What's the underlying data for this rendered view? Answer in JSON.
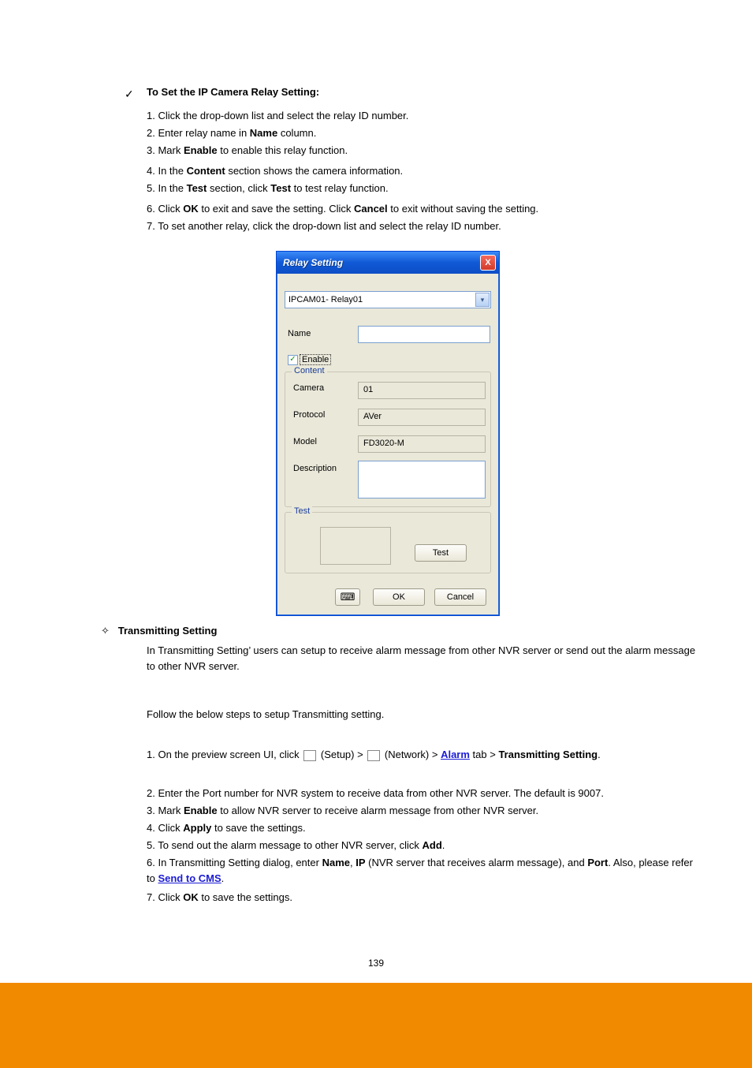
{
  "bullet": {
    "heading": "To Set the IP Camera Relay Setting:"
  },
  "relaySteps": {
    "l1": "1. Click the drop-down list and select the relay ID number.",
    "l2": "2. Enter relay name in Name column.",
    "l3": "3. Mark Enable to enable this relay function.",
    "l4": "4. In the Content section shows the camera information.",
    "l5": "5. In the Test section, click Test to test relay function.",
    "l6": "6. Click OK to exit and save the setting. Click Cancel to exit without saving the setting.",
    "l7": "7. To set another relay, click the drop-down list and select the relay ID number."
  },
  "dialog": {
    "title": "Relay Setting",
    "closeGlyph": "X",
    "dropdown": {
      "selected": "IPCAM01- Relay01"
    },
    "nameLabel": "Name",
    "enableLabel": "Enable",
    "enableChecked": "✓",
    "contentLegend": "Content",
    "cameraLabel": "Camera",
    "cameraValue": "01",
    "protocolLabel": "Protocol",
    "protocolValue": "AVer",
    "modelLabel": "Model",
    "modelValue": "FD3020-M",
    "descriptionLabel": "Description",
    "testLegend": "Test",
    "testBtn": "Test",
    "okBtn": "OK",
    "cancelBtn": "Cancel",
    "kbIcon": "⌨"
  },
  "transmitter": {
    "diamond": "✧",
    "heading": "Transmitting Setting",
    "paraA": "In Transmitting Setting, users can setup to receive alarm message from other NVR server or send out the alarm message to other NVR server.",
    "paraB": "Follow the below steps to setup Transmitting setting.",
    "n1a": "1. On the preview screen UI, click ",
    "n1b": " (Setup) > ",
    "n1c": " (Network) > ",
    "n1d": "Alarm",
    "n1e": " tab > ",
    "n1f": "Transmitting Setting",
    "n1g": ".",
    "n2": "2. Enter the Port number for NVR system to receive data from other NVR server. The default is 9007.",
    "n3a": "3. Mark ",
    "n3b": "Enable ",
    "n3c": "to allow NVR server to receive alarm message from other NVR server.",
    "n4a": "4. Click ",
    "n4b": "Apply",
    "n4c": " to save the settings.",
    "n5": "5. To send out the alarm message to other NVR server, click Add.",
    "n6a": "6. In Transmitting Setting dialog, enter ",
    "n6b": "Name",
    "n6c": ", ",
    "n6d": "IP",
    "n6e": " (NVR server that receives alarm message), and ",
    "n6f": "Port",
    "n6g": ". Also, please refer to ",
    "n6link": "Send to CMS",
    "n6h": ".",
    "n7a": "7. Click ",
    "n7b": "OK",
    "n7c": " to save the settings."
  },
  "links": {
    "alarm": "Alarm"
  },
  "page": {
    "number": "139"
  }
}
